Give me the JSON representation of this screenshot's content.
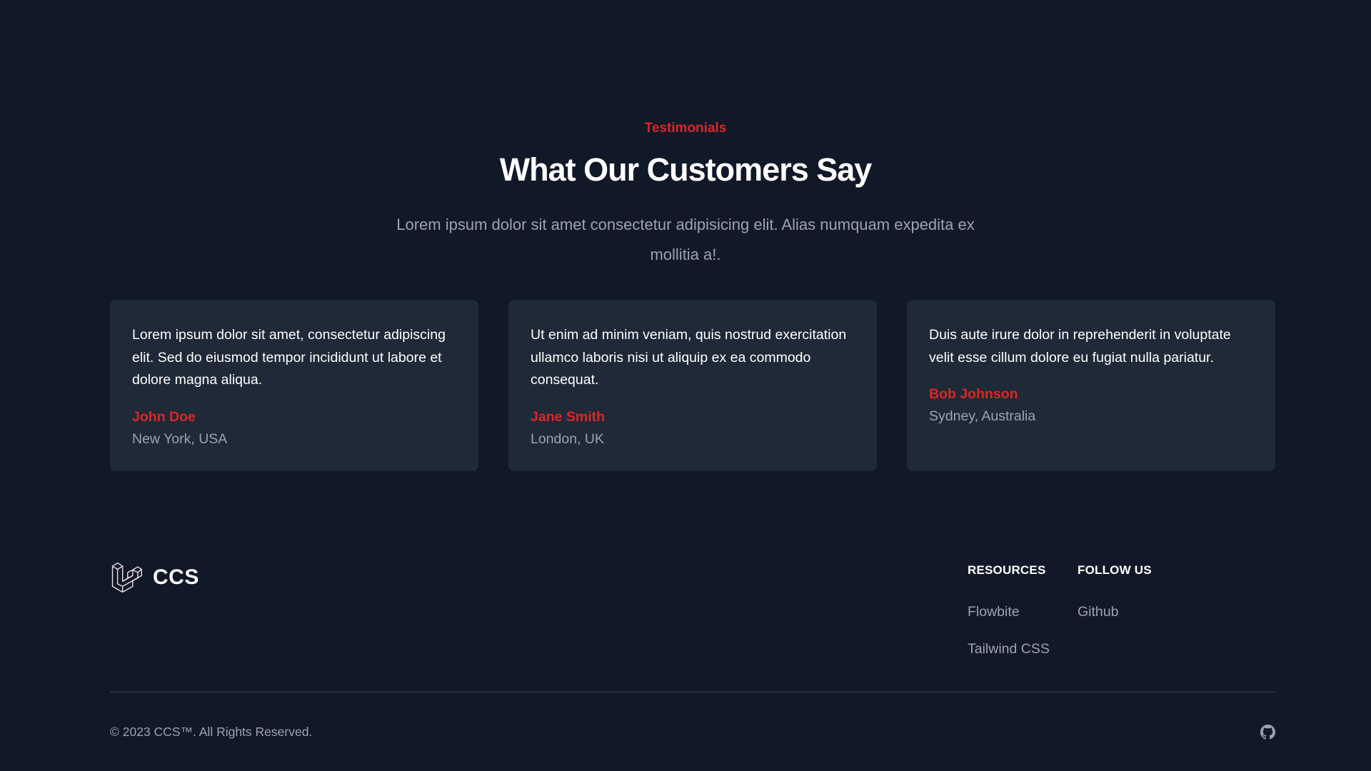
{
  "testimonials": {
    "eyebrow": "Testimonials",
    "heading": "What Our Customers Say",
    "lead": "Lorem ipsum dolor sit amet consectetur adipisicing elit. Alias numquam expedita ex mollitia a!.",
    "cards": [
      {
        "quote": "Lorem ipsum dolor sit amet, consectetur adipiscing elit. Sed do eiusmod tempor incididunt ut labore et dolore magna aliqua.",
        "author": "John Doe",
        "location": "New York, USA"
      },
      {
        "quote": "Ut enim ad minim veniam, quis nostrud exercitation ullamco laboris nisi ut aliquip ex ea commodo consequat.",
        "author": "Jane Smith",
        "location": "London, UK"
      },
      {
        "quote": "Duis aute irure dolor in reprehenderit in voluptate velit esse cillum dolore eu fugiat nulla pariatur.",
        "author": "Bob Johnson",
        "location": "Sydney, Australia"
      }
    ]
  },
  "footer": {
    "brand": {
      "name": "CCS",
      "icon": "laravel-logo-icon"
    },
    "resources": {
      "title": "RESOURCES",
      "links": [
        "Flowbite",
        "Tailwind CSS"
      ]
    },
    "follow": {
      "title": "FOLLOW US",
      "links": [
        "Github"
      ]
    },
    "copyright": "© 2023 CCS™. All Rights Reserved.",
    "social_icon": "github-icon"
  },
  "colors": {
    "background": "#111827",
    "card": "#1f2937",
    "accent": "#dc2626",
    "muted": "#9ca3af",
    "divider": "#374151"
  }
}
